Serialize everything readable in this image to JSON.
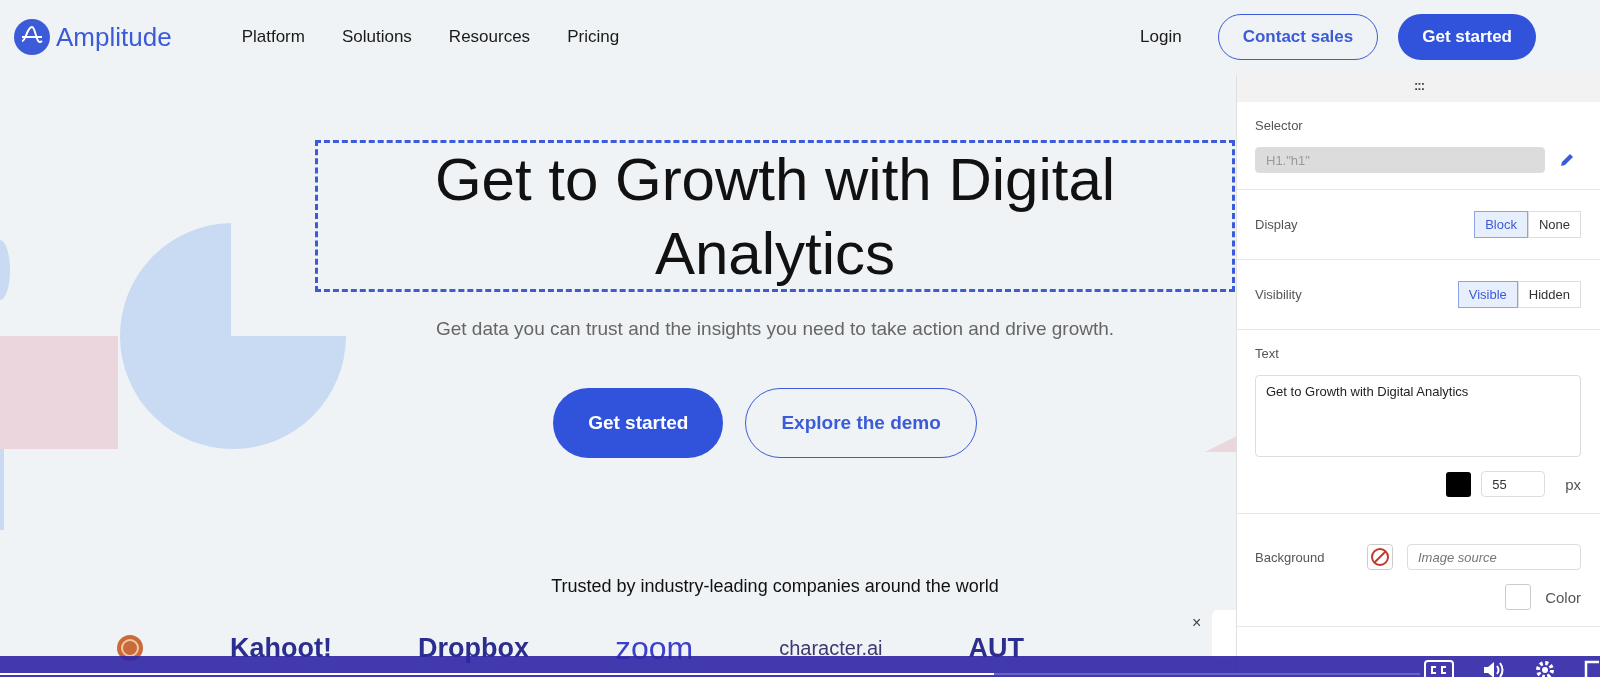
{
  "nav": {
    "logo": "Amplitude",
    "links": [
      "Platform",
      "Solutions",
      "Resources",
      "Pricing"
    ],
    "login": "Login",
    "contact": "Contact sales",
    "cta": "Get started"
  },
  "hero": {
    "heading": "Get to Growth with Digital Analytics",
    "highlighted": true,
    "subtitle": "Get data you can trust and the insights you need to take action and drive growth.",
    "buttons": [
      {
        "label": "Get started",
        "kind": "primary"
      },
      {
        "label": "Explore the demo",
        "kind": "secondary"
      }
    ]
  },
  "trusted": {
    "title": "Trusted by industry-leading companies around the world",
    "logos": [
      "Kahoot!",
      "Dropbox",
      "zoom",
      "character.ai",
      "AUT"
    ]
  },
  "popup": {
    "close": "×"
  },
  "editor": {
    "handle": ":::",
    "selector": {
      "label": "Selector",
      "value": "H1.\"h1\"",
      "disabled": true
    },
    "display": {
      "label": "Display",
      "options": [
        {
          "label": "Block",
          "selected": true
        },
        {
          "label": "None",
          "selected": false
        }
      ]
    },
    "visibility": {
      "label": "Visibility",
      "options": [
        {
          "label": "Visible",
          "selected": true
        },
        {
          "label": "Hidden",
          "selected": false
        }
      ]
    },
    "text": {
      "label": "Text",
      "value": "Get to Growth with Digital Analytics",
      "color": "#000000",
      "size": "55",
      "unit": "px"
    },
    "background": {
      "label": "Background",
      "placeholder": "Image source",
      "color_label": "Color",
      "color_checked": false
    }
  },
  "player": {
    "level": 0.7
  }
}
